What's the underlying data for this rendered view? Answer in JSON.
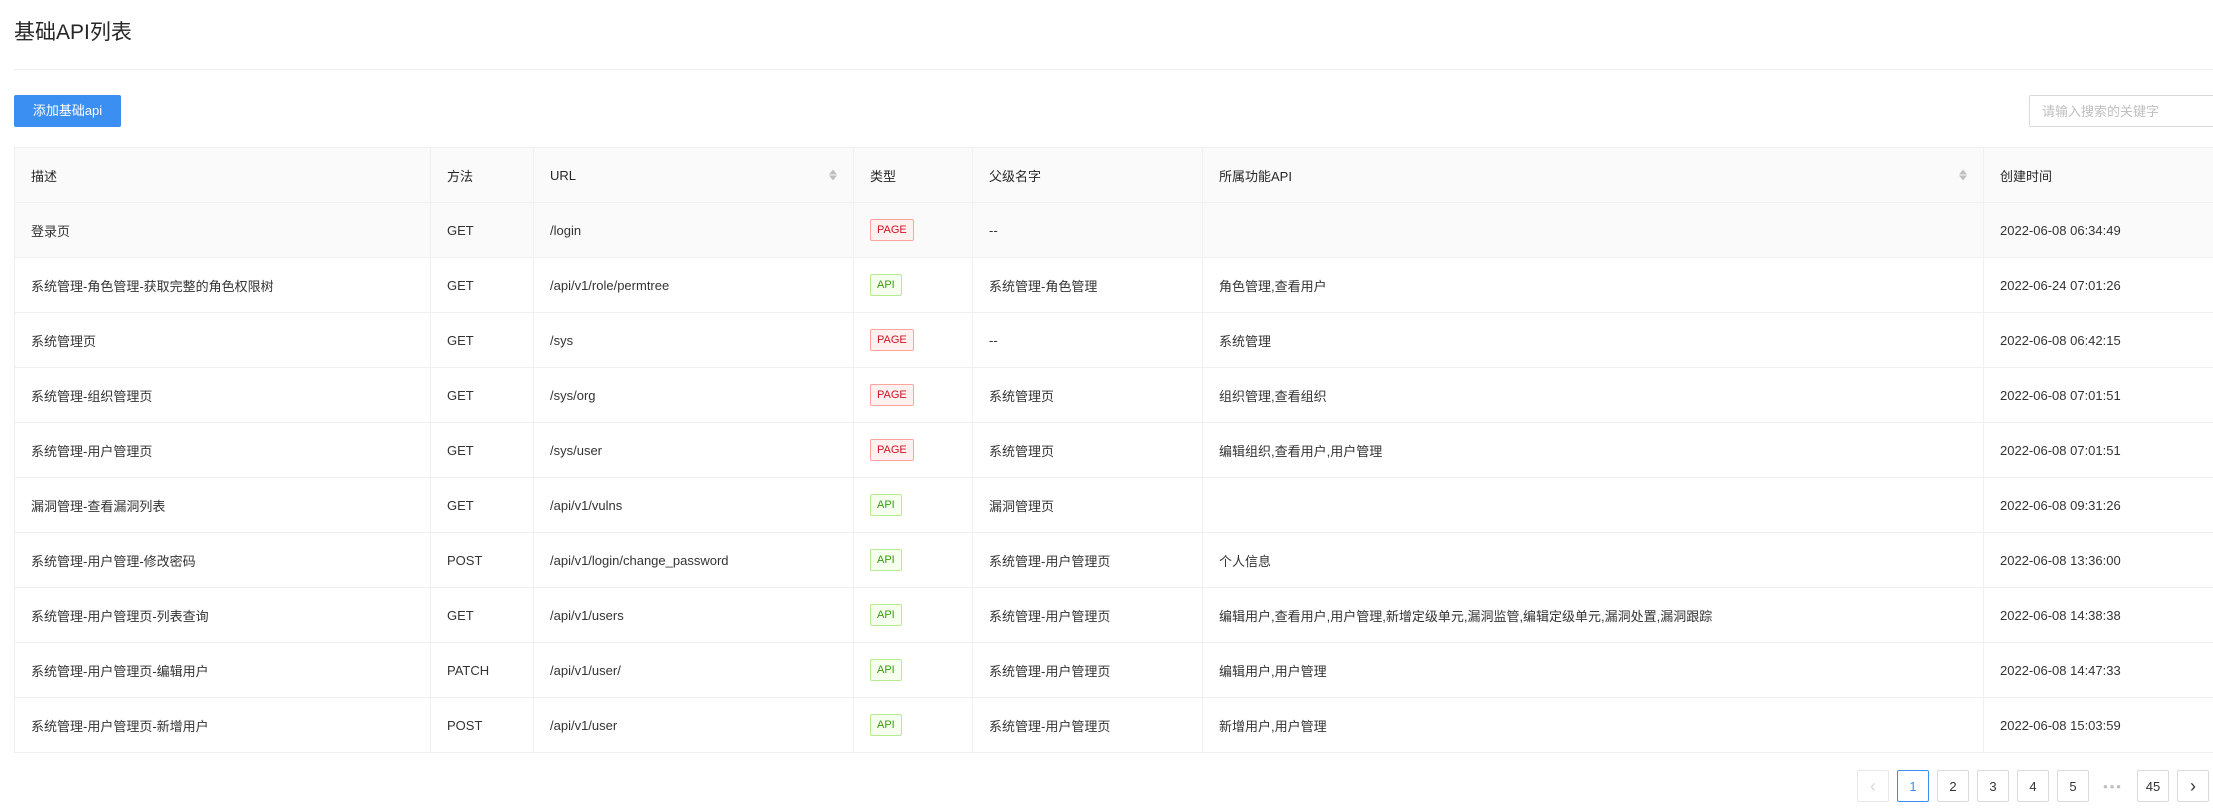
{
  "page": {
    "title": "基础API列表"
  },
  "toolbar": {
    "add_label": "添加基础api",
    "search_placeholder": "请输入搜索的关键字"
  },
  "table": {
    "columns": [
      "描述",
      "方法",
      "URL",
      "类型",
      "父级名字",
      "所属功能API",
      "创建时间"
    ],
    "rows": [
      {
        "desc": "登录页",
        "method": "GET",
        "url": "/login",
        "type": "PAGE",
        "parent": "--",
        "feature": "",
        "created": "2022-06-08 06:34:49"
      },
      {
        "desc": "系统管理-角色管理-获取完整的角色权限树",
        "method": "GET",
        "url": "/api/v1/role/permtree",
        "type": "API",
        "parent": "系统管理-角色管理",
        "feature": "角色管理,查看用户",
        "created": "2022-06-24 07:01:26"
      },
      {
        "desc": "系统管理页",
        "method": "GET",
        "url": "/sys",
        "type": "PAGE",
        "parent": "--",
        "feature": "系统管理",
        "created": "2022-06-08 06:42:15"
      },
      {
        "desc": "系统管理-组织管理页",
        "method": "GET",
        "url": "/sys/org",
        "type": "PAGE",
        "parent": "系统管理页",
        "feature": "组织管理,查看组织",
        "created": "2022-06-08 07:01:51"
      },
      {
        "desc": "系统管理-用户管理页",
        "method": "GET",
        "url": "/sys/user",
        "type": "PAGE",
        "parent": "系统管理页",
        "feature": "编辑组织,查看用户,用户管理",
        "created": "2022-06-08 07:01:51"
      },
      {
        "desc": "漏洞管理-查看漏洞列表",
        "method": "GET",
        "url": "/api/v1/vulns",
        "type": "API",
        "parent": "漏洞管理页",
        "feature": "",
        "created": "2022-06-08 09:31:26"
      },
      {
        "desc": "系统管理-用户管理-修改密码",
        "method": "POST",
        "url": "/api/v1/login/change_password",
        "type": "API",
        "parent": "系统管理-用户管理页",
        "feature": "个人信息",
        "created": "2022-06-08 13:36:00"
      },
      {
        "desc": "系统管理-用户管理页-列表查询",
        "method": "GET",
        "url": "/api/v1/users",
        "type": "API",
        "parent": "系统管理-用户管理页",
        "feature": "编辑用户,查看用户,用户管理,新增定级单元,漏洞监管,编辑定级单元,漏洞处置,漏洞跟踪",
        "created": "2022-06-08 14:38:38"
      },
      {
        "desc": "系统管理-用户管理页-编辑用户",
        "method": "PATCH",
        "url": "/api/v1/user/",
        "type": "API",
        "parent": "系统管理-用户管理页",
        "feature": "编辑用户,用户管理",
        "created": "2022-06-08 14:47:33"
      },
      {
        "desc": "系统管理-用户管理页-新增用户",
        "method": "POST",
        "url": "/api/v1/user",
        "type": "API",
        "parent": "系统管理-用户管理页",
        "feature": "新增用户,用户管理",
        "created": "2022-06-08 15:03:59"
      }
    ]
  },
  "pagination": {
    "pages": [
      "1",
      "2",
      "3",
      "4",
      "5"
    ],
    "ellipsis": "•••",
    "last": "45",
    "current": "1",
    "prev_icon": "chevron-left-icon",
    "next_icon": "chevron-right-icon"
  },
  "colors": {
    "primary": "#3b8ff3",
    "tag_page": "#cf1322",
    "tag_api": "#389e0d"
  }
}
